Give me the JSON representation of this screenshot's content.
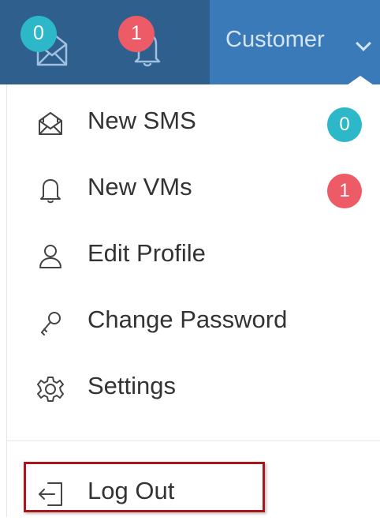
{
  "topbar": {
    "messages_badge": "0",
    "notifications_badge": "1",
    "user_menu_label": "Customer"
  },
  "menu": {
    "items": [
      {
        "label": "New SMS",
        "icon": "sms-envelope-icon",
        "badge": "0",
        "badge_color": "#2cb8c8"
      },
      {
        "label": "New VMs",
        "icon": "bell-icon",
        "badge": "1",
        "badge_color": "#ec5b66"
      },
      {
        "label": "Edit Profile",
        "icon": "user-icon"
      },
      {
        "label": "Change Password",
        "icon": "key-icon"
      },
      {
        "label": "Settings",
        "icon": "gear-icon"
      }
    ],
    "logout_label": "Log Out",
    "logout_icon": "logout-icon"
  },
  "colors": {
    "topbar_bg": "#2e5f8d",
    "active_tab_bg": "#3a7ab8",
    "teal_badge": "#2cb8c8",
    "red_badge": "#ec5b66",
    "highlight_border": "#a8171c"
  }
}
